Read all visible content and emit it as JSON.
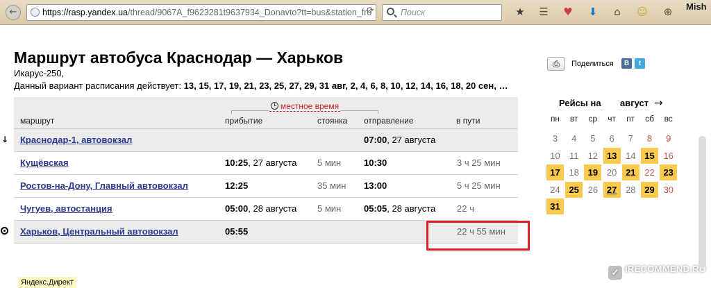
{
  "browser": {
    "url_domain": "https://rasp.yandex.ua",
    "url_path": "/thread/9067A_f9623281t9637934_Donavto?tt=bus&station_fro",
    "search_placeholder": "Поиск",
    "profile": "Mish"
  },
  "page": {
    "title": "Маршрут автобуса Краснодар — Харьков",
    "bus_model": "Икарус-250,",
    "validity_label": "Данный вариант расписания действует:",
    "validity_dates": "13, 15, 17, 19, 21, 23, 25, 27, 29, 31 авг, 2, 4, 6, 8, 10, 12, 14, 16, 18, 20 сен, …"
  },
  "table": {
    "local_time": "местное время",
    "headers": {
      "route": "маршрут",
      "arrival": "прибытие",
      "stop": "стоянка",
      "departure": "отправление",
      "duration": "в пути"
    },
    "rows": [
      {
        "stop": "Краснодар-1, автовокзал",
        "arr_time": "",
        "arr_date": "",
        "park": "",
        "dep_time": "07:00",
        "dep_date": ", 27 августа",
        "duration": ""
      },
      {
        "stop": "Кущёвская",
        "arr_time": "10:25",
        "arr_date": ", 27 августа",
        "park": "5 мин",
        "dep_time": "10:30",
        "dep_date": "",
        "duration": "3 ч 25 мин"
      },
      {
        "stop": "Ростов-на-Дону, Главный автовокзал",
        "arr_time": "12:25",
        "arr_date": "",
        "park": "35 мин",
        "dep_time": "13:00",
        "dep_date": "",
        "duration": "5 ч 25 мин"
      },
      {
        "stop": "Чугуев, автостанция",
        "arr_time": "05:00",
        "arr_date": ", 28 августа",
        "park": "5 мин",
        "dep_time": "05:05",
        "dep_date": ", 28 августа",
        "duration": "22 ч"
      },
      {
        "stop": "Харьков, Центральный автовокзал",
        "arr_time": "05:55",
        "arr_date": "",
        "park": "",
        "dep_time": "",
        "dep_date": "",
        "duration": "22 ч 55 мин"
      }
    ]
  },
  "sidebar": {
    "share": "Поделиться",
    "vk": "В",
    "tw": "t",
    "calendar_title": "Рейсы на",
    "calendar_month": "август",
    "next_arrow": "→",
    "weekdays": [
      "пн",
      "вт",
      "ср",
      "чт",
      "пт",
      "сб",
      "вс"
    ],
    "days": [
      [
        "",
        "",
        "",
        "",
        "",
        "",
        ""
      ],
      [
        "3",
        "4",
        "5",
        "6",
        "7",
        "8",
        "9"
      ],
      [
        "10",
        "11",
        "12",
        "13",
        "14",
        "15",
        "16"
      ],
      [
        "17",
        "18",
        "19",
        "20",
        "21",
        "22",
        "23"
      ],
      [
        "24",
        "25",
        "26",
        "27",
        "28",
        "29",
        "30"
      ],
      [
        "31",
        "",
        "",
        "",
        "",
        "",
        ""
      ]
    ],
    "active_days": [
      "13",
      "15",
      "17",
      "19",
      "21",
      "23",
      "25",
      "27",
      "29",
      "31"
    ],
    "today": "27"
  },
  "footer": {
    "direct": "Яндекс.Директ",
    "watermark": "iRECOMMEND.RU"
  },
  "colors": {
    "link": "#2a3a8f",
    "local_time": "#cc2222",
    "active_day": "#fbc94c",
    "highlight": "#e02020"
  }
}
